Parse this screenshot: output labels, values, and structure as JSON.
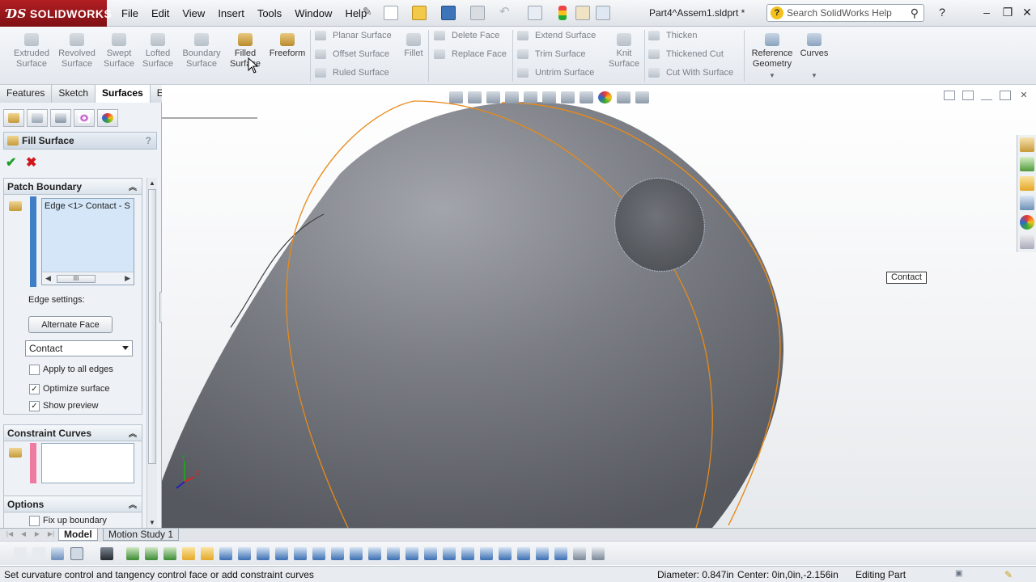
{
  "app": {
    "brand": "SOLIDWORKS",
    "doc_title": "Part4^Assem1.sldprt *",
    "help_search_placeholder": "Search SolidWorks Help"
  },
  "menu": [
    "File",
    "Edit",
    "View",
    "Insert",
    "Tools",
    "Window",
    "Help"
  ],
  "command_manager": {
    "big_buttons": [
      {
        "label": "Extruded\nSurface"
      },
      {
        "label": "Revolved\nSurface"
      },
      {
        "label": "Swept\nSurface"
      },
      {
        "label": "Lofted\nSurface"
      },
      {
        "label": "Boundary\nSurface"
      },
      {
        "label": "Filled\nSurface"
      },
      {
        "label": "Freeform"
      }
    ],
    "group1": [
      "Planar Surface",
      "Offset Surface",
      "Ruled Surface"
    ],
    "fillet": "Fillet",
    "group2": [
      "Delete Face",
      "Replace Face"
    ],
    "group3": [
      "Extend Surface",
      "Trim Surface",
      "Untrim Surface"
    ],
    "knit": "Knit\nSurface",
    "group4": [
      "Thicken",
      "Thickened Cut",
      "Cut With Surface"
    ],
    "reference_geometry": "Reference\nGeometry",
    "curves": "Curves"
  },
  "tabs": [
    "Features",
    "Sketch",
    "Surfaces",
    "Evaluate"
  ],
  "property_manager": {
    "title": "Fill Surface",
    "help": "?",
    "patch_boundary": {
      "title": "Patch Boundary",
      "items": [
        "Edge <1> Contact - S"
      ],
      "scroll_thumb": "III",
      "edge_settings_label": "Edge settings:",
      "alternate_face": "Alternate Face",
      "edge_condition": "Contact",
      "apply_all": {
        "label": "Apply to all edges",
        "checked": false
      },
      "optimize": {
        "label": "Optimize surface",
        "checked": true
      },
      "show_preview": {
        "label": "Show preview",
        "checked": true
      }
    },
    "constraint_curves": {
      "title": "Constraint Curves"
    },
    "options": {
      "title": "Options",
      "fix_up": {
        "label": "Fix up boundary",
        "checked": false
      }
    }
  },
  "graphics": {
    "callout": "Contact",
    "triad": {
      "y": "Y",
      "x": "X"
    }
  },
  "bottom_tabs": [
    "Model",
    "Motion Study 1"
  ],
  "status": {
    "message": "Set curvature control and tangency control face or add constraint curves",
    "diameter": "Diameter: 0.847in",
    "center": "Center: 0in,0in,-2.156in",
    "mode": "Editing Part"
  },
  "colors": {
    "brand_red": "#b21e23",
    "body_gray": "#6f7278",
    "edge_orange": "#e88a1a",
    "selection_blue": "#3f7fc7"
  }
}
